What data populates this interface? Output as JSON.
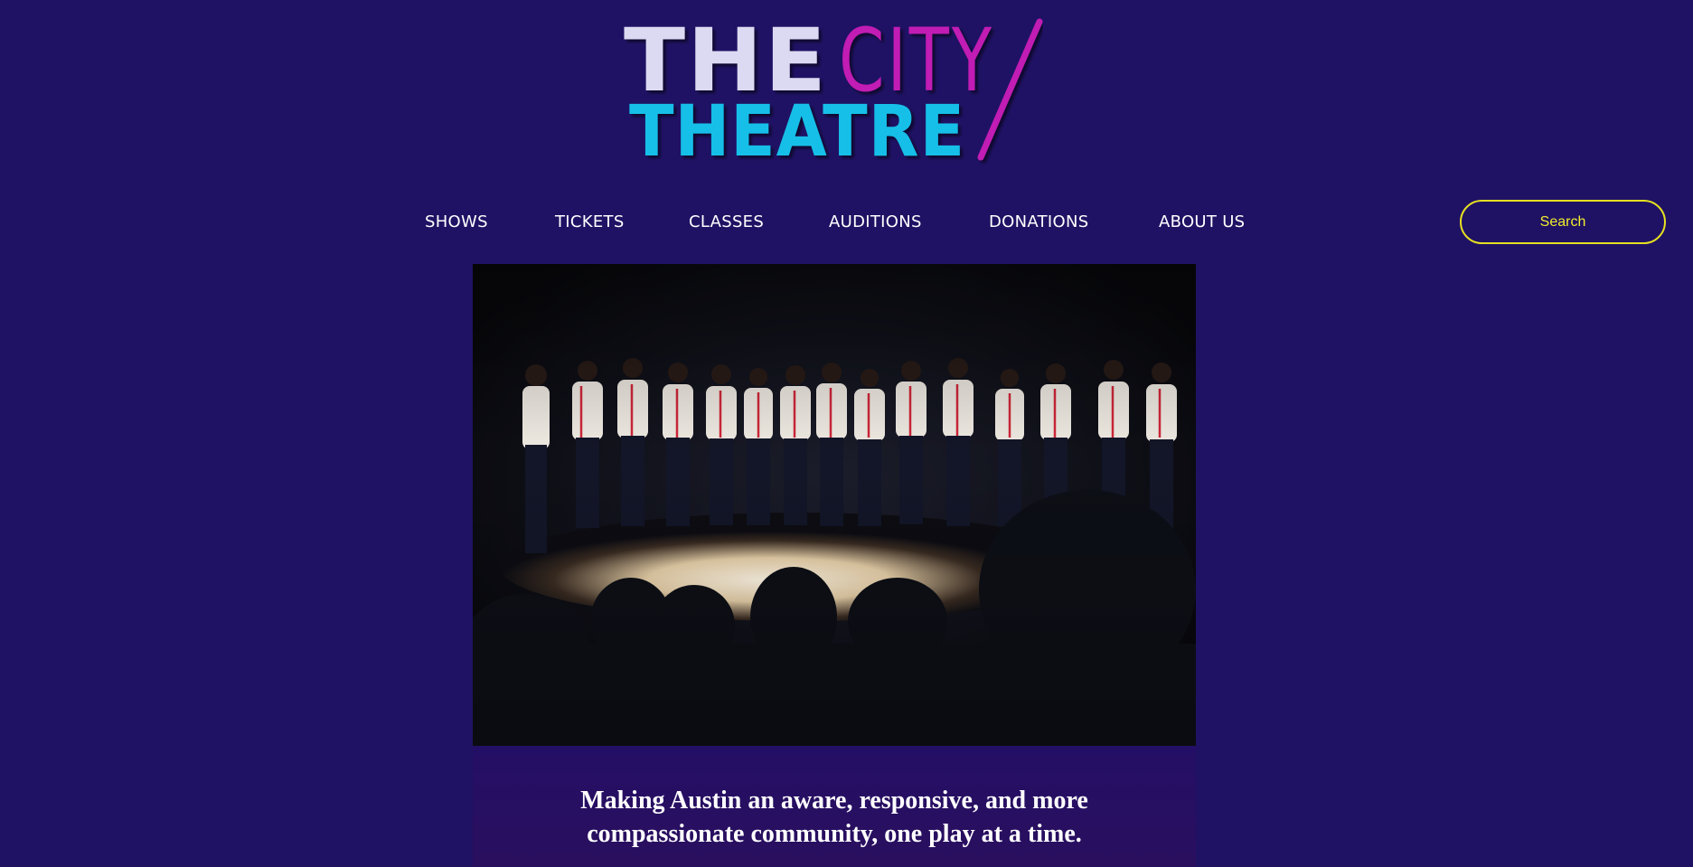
{
  "brand": {
    "line1_the": "THE",
    "line1_city": "CITY",
    "line2": "THEATRE",
    "colors": {
      "the": "#dcdaf2",
      "city": "#c11db4",
      "theatre": "#16bfe8"
    }
  },
  "nav": {
    "items": [
      {
        "label": "SHOWS"
      },
      {
        "label": "TICKETS"
      },
      {
        "label": "CLASSES"
      },
      {
        "label": "AUDITIONS"
      },
      {
        "label": "DONATIONS"
      },
      {
        "label": "ABOUT US"
      }
    ]
  },
  "search": {
    "placeholder": "Search",
    "border_color": "#e6e021"
  },
  "hero": {
    "image": "ensemble-cast-on-stage-photo"
  },
  "tagline": {
    "line1": "Making Austin an aware, responsive, and more",
    "line2": "compassionate community, one play at a time."
  },
  "colors": {
    "background": "#1f1264"
  }
}
